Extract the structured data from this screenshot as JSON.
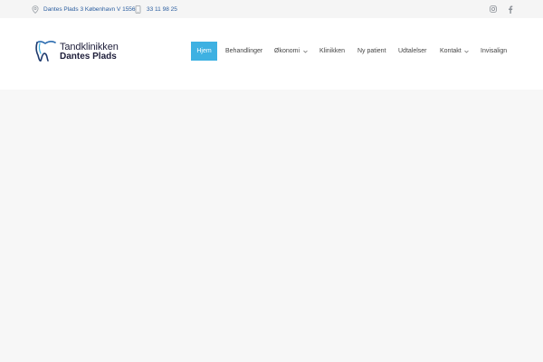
{
  "topbar": {
    "address": "Dantes Plads 3 København V 1556",
    "phone": "33 11 98 25",
    "address_icon": "location-pin-icon",
    "phone_icon": "mobile-phone-icon",
    "social": [
      "instagram-icon",
      "facebook-icon"
    ]
  },
  "logo": {
    "line1": "Tandklinikken",
    "line2": "Dantes Plads",
    "mark_icon": "tooth-icon"
  },
  "nav": {
    "items": [
      {
        "label": "Hjem",
        "active": true,
        "dropdown": false
      },
      {
        "label": "Behandlinger",
        "active": false,
        "dropdown": false
      },
      {
        "label": "Økonomi",
        "active": false,
        "dropdown": true
      },
      {
        "label": "Klinikken",
        "active": false,
        "dropdown": false
      },
      {
        "label": "Ny patient",
        "active": false,
        "dropdown": false
      },
      {
        "label": "Udtalelser",
        "active": false,
        "dropdown": false
      },
      {
        "label": "Kontakt",
        "active": false,
        "dropdown": true
      },
      {
        "label": "Invisalign",
        "active": false,
        "dropdown": false
      }
    ]
  },
  "colors": {
    "accent": "#3eb1e2",
    "topbar_text": "#2a5d9f",
    "logo_text": "#1e1e3a",
    "logo_mark": "#2b6cb0",
    "background": "#f7f7f7"
  }
}
